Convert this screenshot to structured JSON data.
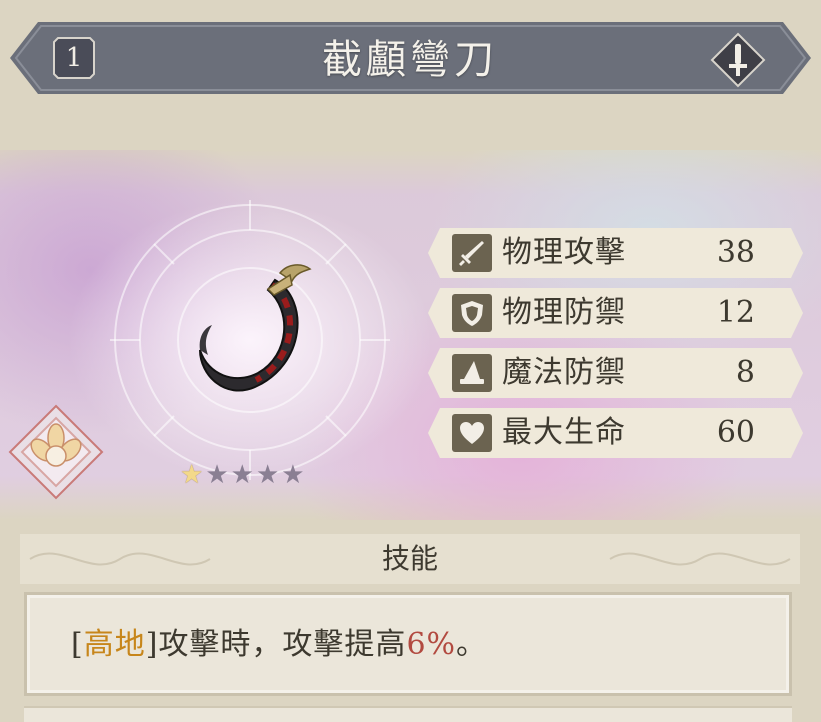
{
  "header": {
    "level": "1",
    "title": "截顱彎刀",
    "type_icon": "sword-icon"
  },
  "weapon": {
    "image": "curved-scythe-blade",
    "rarity_max": 5,
    "rarity": 1
  },
  "stats": [
    {
      "icon": "sword-icon",
      "label": "物理攻擊",
      "value": "38"
    },
    {
      "icon": "shield-icon",
      "label": "物理防禦",
      "value": "12"
    },
    {
      "icon": "wizard-hat-icon",
      "label": "魔法防禦",
      "value": "8"
    },
    {
      "icon": "heart-icon",
      "label": "最大生命",
      "value": "60"
    }
  ],
  "skill": {
    "title": "技能",
    "open_bracket": "[",
    "keyword": "高地",
    "close_bracket": "]",
    "text_before": "攻擊時，攻擊提高",
    "percent": "6%",
    "text_after": "。"
  },
  "colors": {
    "banner": "#6b6f7a",
    "keyword": "#c7861b",
    "percent": "#b24a40",
    "stat_icon_bg": "#6b6350"
  }
}
